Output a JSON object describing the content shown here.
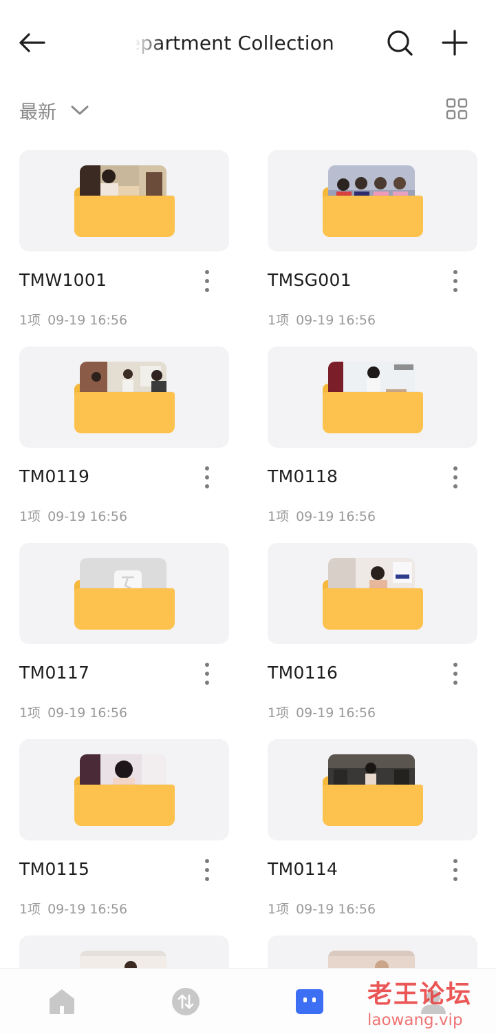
{
  "header": {
    "title": "Department Collection",
    "back_icon": "arrow-left-icon",
    "search_icon": "search-icon",
    "add_icon": "plus-icon"
  },
  "sort": {
    "label": "最新",
    "chevron_icon": "chevron-down-icon",
    "view_icon": "grid-view-icon"
  },
  "folders": [
    {
      "name": "TMW1001",
      "count": "1项",
      "date": "09-19 16:56",
      "preview": "photo"
    },
    {
      "name": "TMSG001",
      "count": "1项",
      "date": "09-19 16:56",
      "preview": "photo"
    },
    {
      "name": "TM0119",
      "count": "1项",
      "date": "09-19 16:56",
      "preview": "photo"
    },
    {
      "name": "TM0118",
      "count": "1项",
      "date": "09-19 16:56",
      "preview": "photo"
    },
    {
      "name": "TM0117",
      "count": "1项",
      "date": "09-19 16:56",
      "preview": "placeholder"
    },
    {
      "name": "TM0116",
      "count": "1项",
      "date": "09-19 16:56",
      "preview": "photo"
    },
    {
      "name": "TM0115",
      "count": "1项",
      "date": "09-19 16:56",
      "preview": "photo"
    },
    {
      "name": "TM0114",
      "count": "1项",
      "date": "09-19 16:56",
      "preview": "photo"
    }
  ],
  "bottom_nav": {
    "items": [
      {
        "icon": "home-icon"
      },
      {
        "icon": "transfer-icon"
      },
      {
        "icon": "files-icon",
        "active": true
      },
      {
        "icon": "profile-icon"
      }
    ],
    "active_color": "#3d6ff5"
  },
  "watermark": {
    "line1": "老王论坛",
    "line2": "laowang.vip"
  },
  "colors": {
    "folder": "#fdc24d",
    "card_bg": "#f3f3f5",
    "meta_text": "#9a9a9a"
  }
}
